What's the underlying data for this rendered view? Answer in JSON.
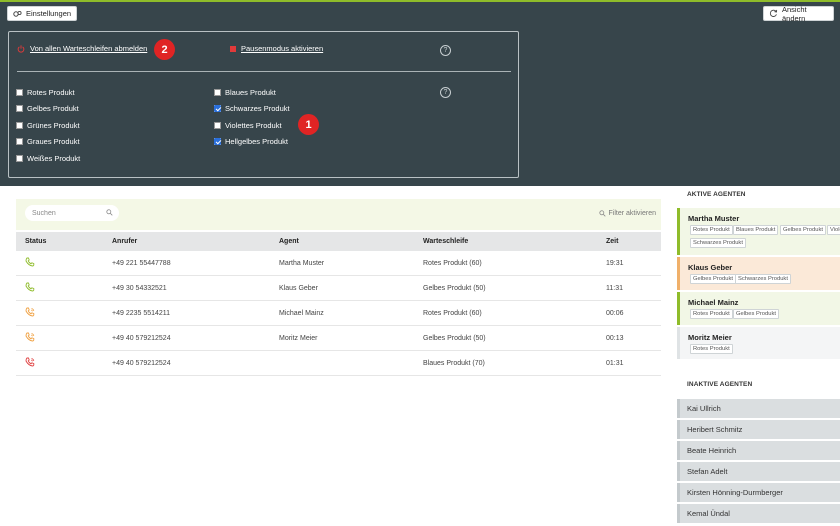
{
  "header": {
    "settings_label": "Einstellungen",
    "view_label": "Ansicht ändern"
  },
  "panel": {
    "logout_all": "Von allen Warteschleifen abmelden",
    "pause_mode": "Pausenmodus aktivieren",
    "help": "?",
    "badge_1": "1",
    "badge_2": "2",
    "products": [
      {
        "label": "Rotes Produkt",
        "checked": false
      },
      {
        "label": "Gelbes Produkt",
        "checked": false
      },
      {
        "label": "Grünes Produkt",
        "checked": false
      },
      {
        "label": "Graues Produkt",
        "checked": false
      },
      {
        "label": "Weißes Produkt",
        "checked": false
      },
      {
        "label": "Blaues Produkt",
        "checked": false
      },
      {
        "label": "Schwarzes Produkt",
        "checked": true
      },
      {
        "label": "Violettes Produkt",
        "checked": false
      },
      {
        "label": "Hellgelbes Produkt",
        "checked": true
      }
    ]
  },
  "search": {
    "placeholder": "Suchen"
  },
  "filter_label": "Filter aktivieren",
  "table": {
    "headers": [
      "Status",
      "Anrufer",
      "Agent",
      "Warteschleife",
      "Zeit"
    ],
    "rows": [
      {
        "status": "active",
        "caller": "+49 221 55447788",
        "agent": "Martha Muster",
        "queue": "Rotes Produkt (60)",
        "time": "19:31"
      },
      {
        "status": "active",
        "caller": "+49 30 54332521",
        "agent": "Klaus Geber",
        "queue": "Gelbes Produkt (50)",
        "time": "11:31"
      },
      {
        "status": "ringing",
        "caller": "+49 2235 5514211",
        "agent": "Michael Mainz",
        "queue": "Rotes Produkt (60)",
        "time": "00:06"
      },
      {
        "status": "ringing",
        "caller": "+49 40 579212524",
        "agent": "Moritz Meier",
        "queue": "Gelbes Produkt (50)",
        "time": "00:13"
      },
      {
        "status": "waiting",
        "caller": "+49 40 579212524",
        "agent": "",
        "queue": "Blaues Produkt (70)",
        "time": "01:31"
      }
    ]
  },
  "sidebar": {
    "active_title": "AKTIVE AGENTEN",
    "inactive_title": "INAKTIVE AGENTEN",
    "active_agents": [
      {
        "name": "Martha Muster",
        "state": "available",
        "tags": [
          "Rotes Produkt",
          "Blaues Produkt",
          "Gelbes Produkt",
          "Violett",
          "Schwarzes Produkt"
        ]
      },
      {
        "name": "Klaus Geber",
        "state": "busy",
        "tags": [
          "Gelbes Produkt",
          "Schwarzes Produkt"
        ]
      },
      {
        "name": "Michael Mainz",
        "state": "available",
        "tags": [
          "Rotes Produkt",
          "Gelbes Produkt"
        ]
      },
      {
        "name": "Moritz Meier",
        "state": "idle",
        "tags": [
          "Rotes Produkt"
        ]
      }
    ],
    "inactive_agents": [
      "Kai Ullrich",
      "Heribert Schmitz",
      "Beate Heinrich",
      "Stefan Adelt",
      "Kirsten Hönning-Durmberger",
      "Kemal Ündal"
    ]
  },
  "colors": {
    "accent": "#8fbc2a",
    "header_bg": "#37454b",
    "badge": "#e02424",
    "call_active": "#8fbc2a",
    "call_ringing": "#f0a040",
    "call_waiting": "#e04040"
  }
}
